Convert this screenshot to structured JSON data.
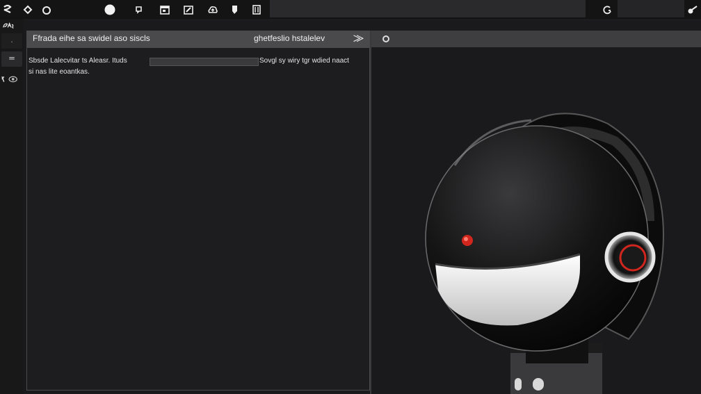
{
  "toolbar": {
    "icons": [
      "mic-icon",
      "diamond-icon",
      "ring-icon",
      "record-icon",
      "chat-icon",
      "calendar-icon",
      "edit-icon",
      "cloud-upload-icon",
      "tag-icon",
      "bookmark-icon"
    ],
    "search_value": "",
    "right_icon": "refresh-icon",
    "far_right_icon": "key-icon"
  },
  "sidebar": {
    "top_icon": "speech-icon",
    "items": [
      "menu-icon",
      "list-icon",
      "eye-icon"
    ]
  },
  "left_pane": {
    "title": "Ffrada eihe sa swidel aso siscls",
    "right_label": "ghetfeslio hstalelev",
    "chevron": "chevron-right-icon",
    "line1_text": "Sbsde Lalecvitar ts Aleasr. Ituds",
    "line1_right": "Sovgl sy wiry tgr wdied naact",
    "line2_text": "si nas lite eoantkas."
  },
  "right_pane": {
    "header_icon": "dot-icon",
    "image_subject": "robot-head-render"
  },
  "colors": {
    "background": "#1a1a1c",
    "header": "#4a4a4c",
    "accent_red": "#d0261d",
    "visor_glow": "#f2f2f2"
  }
}
